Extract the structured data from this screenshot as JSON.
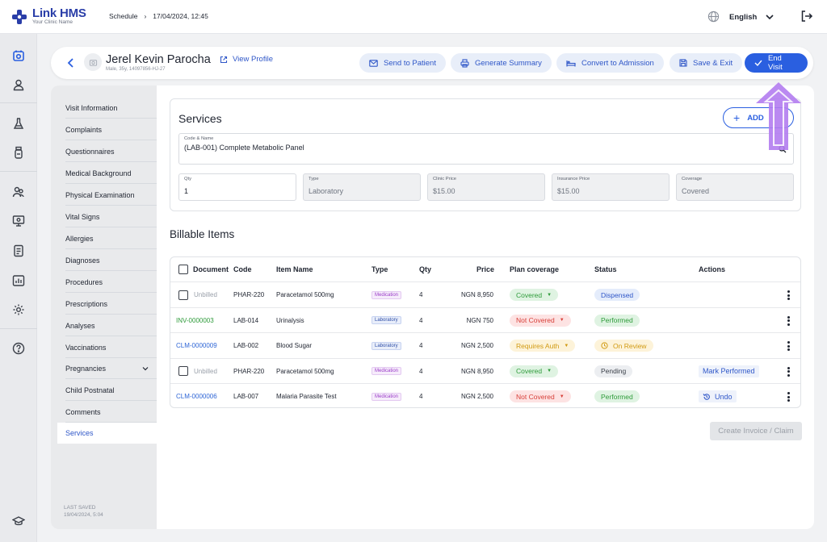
{
  "app": {
    "name": "Link HMS",
    "subtitle": "Your Clinic Name"
  },
  "breadcrumb": {
    "section": "Schedule",
    "current": "17/04/2024, 12:45"
  },
  "topbar": {
    "language": "English"
  },
  "patient": {
    "name": "Jerel Kevin Parocha",
    "meta": "Male, 35y, 14097856-HJ-27",
    "view_profile": "View Profile"
  },
  "actions": {
    "send_to_patient": "Send to Patient",
    "generate_summary": "Generate Summary",
    "convert_to_admission": "Convert to Admission",
    "save_exit": "Save & Exit",
    "end_visit": "End Visit"
  },
  "nav": {
    "items": [
      "Visit Information",
      "Complaints",
      "Questionnaires",
      "Medical Background",
      "Physical Examination",
      "Vital Signs",
      "Allergies",
      "Diagnoses",
      "Procedures",
      "Prescriptions",
      "Analyses",
      "Vaccinations",
      "Pregnancies",
      "Child Postnatal",
      "Comments",
      "Services"
    ],
    "active": "Services",
    "last_saved_label": "LAST SAVED",
    "last_saved_value": "19/04/2024, 5:04"
  },
  "services": {
    "title": "Services",
    "add_label": "ADD",
    "code_name_label": "Code & Name",
    "code_name_value": "(LAB-001) Complete Metabolic Panel",
    "qty_label": "Qty",
    "qty_value": "1",
    "type_label": "Type",
    "type_value": "Laboratory",
    "clinic_price_label": "Clinic Price",
    "clinic_price_value": "$15.00",
    "insurance_price_label": "Insurance Price",
    "insurance_price_value": "$15.00",
    "coverage_label": "Coverage",
    "coverage_value": "Covered"
  },
  "billable": {
    "title": "Billable Items",
    "headers": {
      "document": "Document",
      "code": "Code",
      "item_name": "Item Name",
      "type": "Type",
      "qty": "Qty",
      "price": "Price",
      "plan_coverage": "Plan coverage",
      "status": "Status",
      "actions": "Actions"
    },
    "rows": [
      {
        "document": "Unbilled",
        "code": "PHAR-220",
        "item": "Paracetamol 500mg",
        "type": "Medication",
        "qty": "4",
        "price": "NGN 8,950",
        "coverage": "Covered",
        "status": "Dispensed",
        "action": ""
      },
      {
        "document": "INV-0000003",
        "code": "LAB-014",
        "item": "Urinalysis",
        "type": "Laboratory",
        "qty": "4",
        "price": "NGN 750",
        "coverage": "Not Covered",
        "status": "Performed",
        "action": ""
      },
      {
        "document": "CLM-0000009",
        "code": "LAB-002",
        "item": "Blood Sugar",
        "type": "Laboratory",
        "qty": "4",
        "price": "NGN 2,500",
        "coverage": "Requires Auth",
        "status": "On Review",
        "action": ""
      },
      {
        "document": "Unbilled",
        "code": "PHAR-220",
        "item": "Paracetamol 500mg",
        "type": "Medication",
        "qty": "4",
        "price": "NGN 8,950",
        "coverage": "Covered",
        "status": "Pending",
        "action": "Mark Performed"
      },
      {
        "document": "CLM-0000006",
        "code": "LAB-007",
        "item": "Malaria Parasite Test",
        "type": "Medication",
        "qty": "4",
        "price": "NGN 2,500",
        "coverage": "Not Covered",
        "status": "Performed",
        "action": "Undo"
      }
    ],
    "create_invoice": "Create Invoice / Claim"
  },
  "colors": {
    "primary": "#2a5fe0",
    "brand": "#2a3ea8",
    "arrow": "#b27cf0"
  }
}
